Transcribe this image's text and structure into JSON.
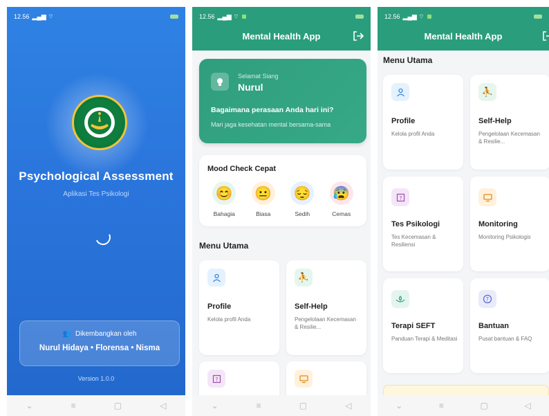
{
  "screen1": {
    "status_time": "12.56",
    "title": "Psychological Assessment",
    "subtitle": "Aplikasi Tes Psikologi",
    "developed_by": "Dikembangkan oleh",
    "developers": "Nurul Hidaya • Florensa • Nisma",
    "version": "Version 1.0.0",
    "logo_icon": "college-seal",
    "colors": {
      "bg_top": "#2f82e3",
      "bg_bottom": "#2369cd"
    }
  },
  "screen2": {
    "status_time": "12.56",
    "app_title": "Mental Health App",
    "greeting_small": "Selamat Siang",
    "greeting_name": "Nurul",
    "question": "Bagaimana perasaan Anda hari ini?",
    "tagline": "Mari jaga kesehatan mental bersama-sama",
    "mood_title": "Mood Check Cepat",
    "moods": [
      {
        "label": "Bahagia",
        "emoji": "😊",
        "color": "#e6f6ec"
      },
      {
        "label": "Biasa",
        "emoji": "😐",
        "color": "#fff1dc"
      },
      {
        "label": "Sedih",
        "emoji": "😔",
        "color": "#e4f1ff"
      },
      {
        "label": "Cemas",
        "emoji": "😰",
        "color": "#fde6ea"
      }
    ],
    "menu_title": "Menu Utama",
    "cards": [
      {
        "title": "Profile",
        "subtitle": "Kelola profil Anda",
        "icon": "person-icon"
      },
      {
        "title": "Self-Help",
        "subtitle": "Pengelolaan Kecemasan & Resilie...",
        "icon": "meditation-icon"
      }
    ],
    "colors": {
      "primary": "#2a9d7c"
    }
  },
  "screen3": {
    "status_time": "12.56",
    "app_title": "Mental Health App",
    "menu_title": "Menu Utama",
    "cards": [
      {
        "title": "Profile",
        "subtitle": "Kelola profil Anda",
        "icon": "person-icon"
      },
      {
        "title": "Self-Help",
        "subtitle": "Pengelolaan Kecemasan & Resilie...",
        "icon": "meditation-icon"
      },
      {
        "title": "Tes Psikologi",
        "subtitle": "Tes Kecemasan & Resiliensi",
        "icon": "quiz-icon"
      },
      {
        "title": "Monitoring",
        "subtitle": "Monitoring Psikologis",
        "icon": "monitor-icon"
      },
      {
        "title": "Terapi SEFT",
        "subtitle": "Panduan Terapi & Meditasi",
        "icon": "therapy-icon"
      },
      {
        "title": "Bantuan",
        "subtitle": "Pusat bantuan & FAQ",
        "icon": "help-icon"
      }
    ]
  }
}
